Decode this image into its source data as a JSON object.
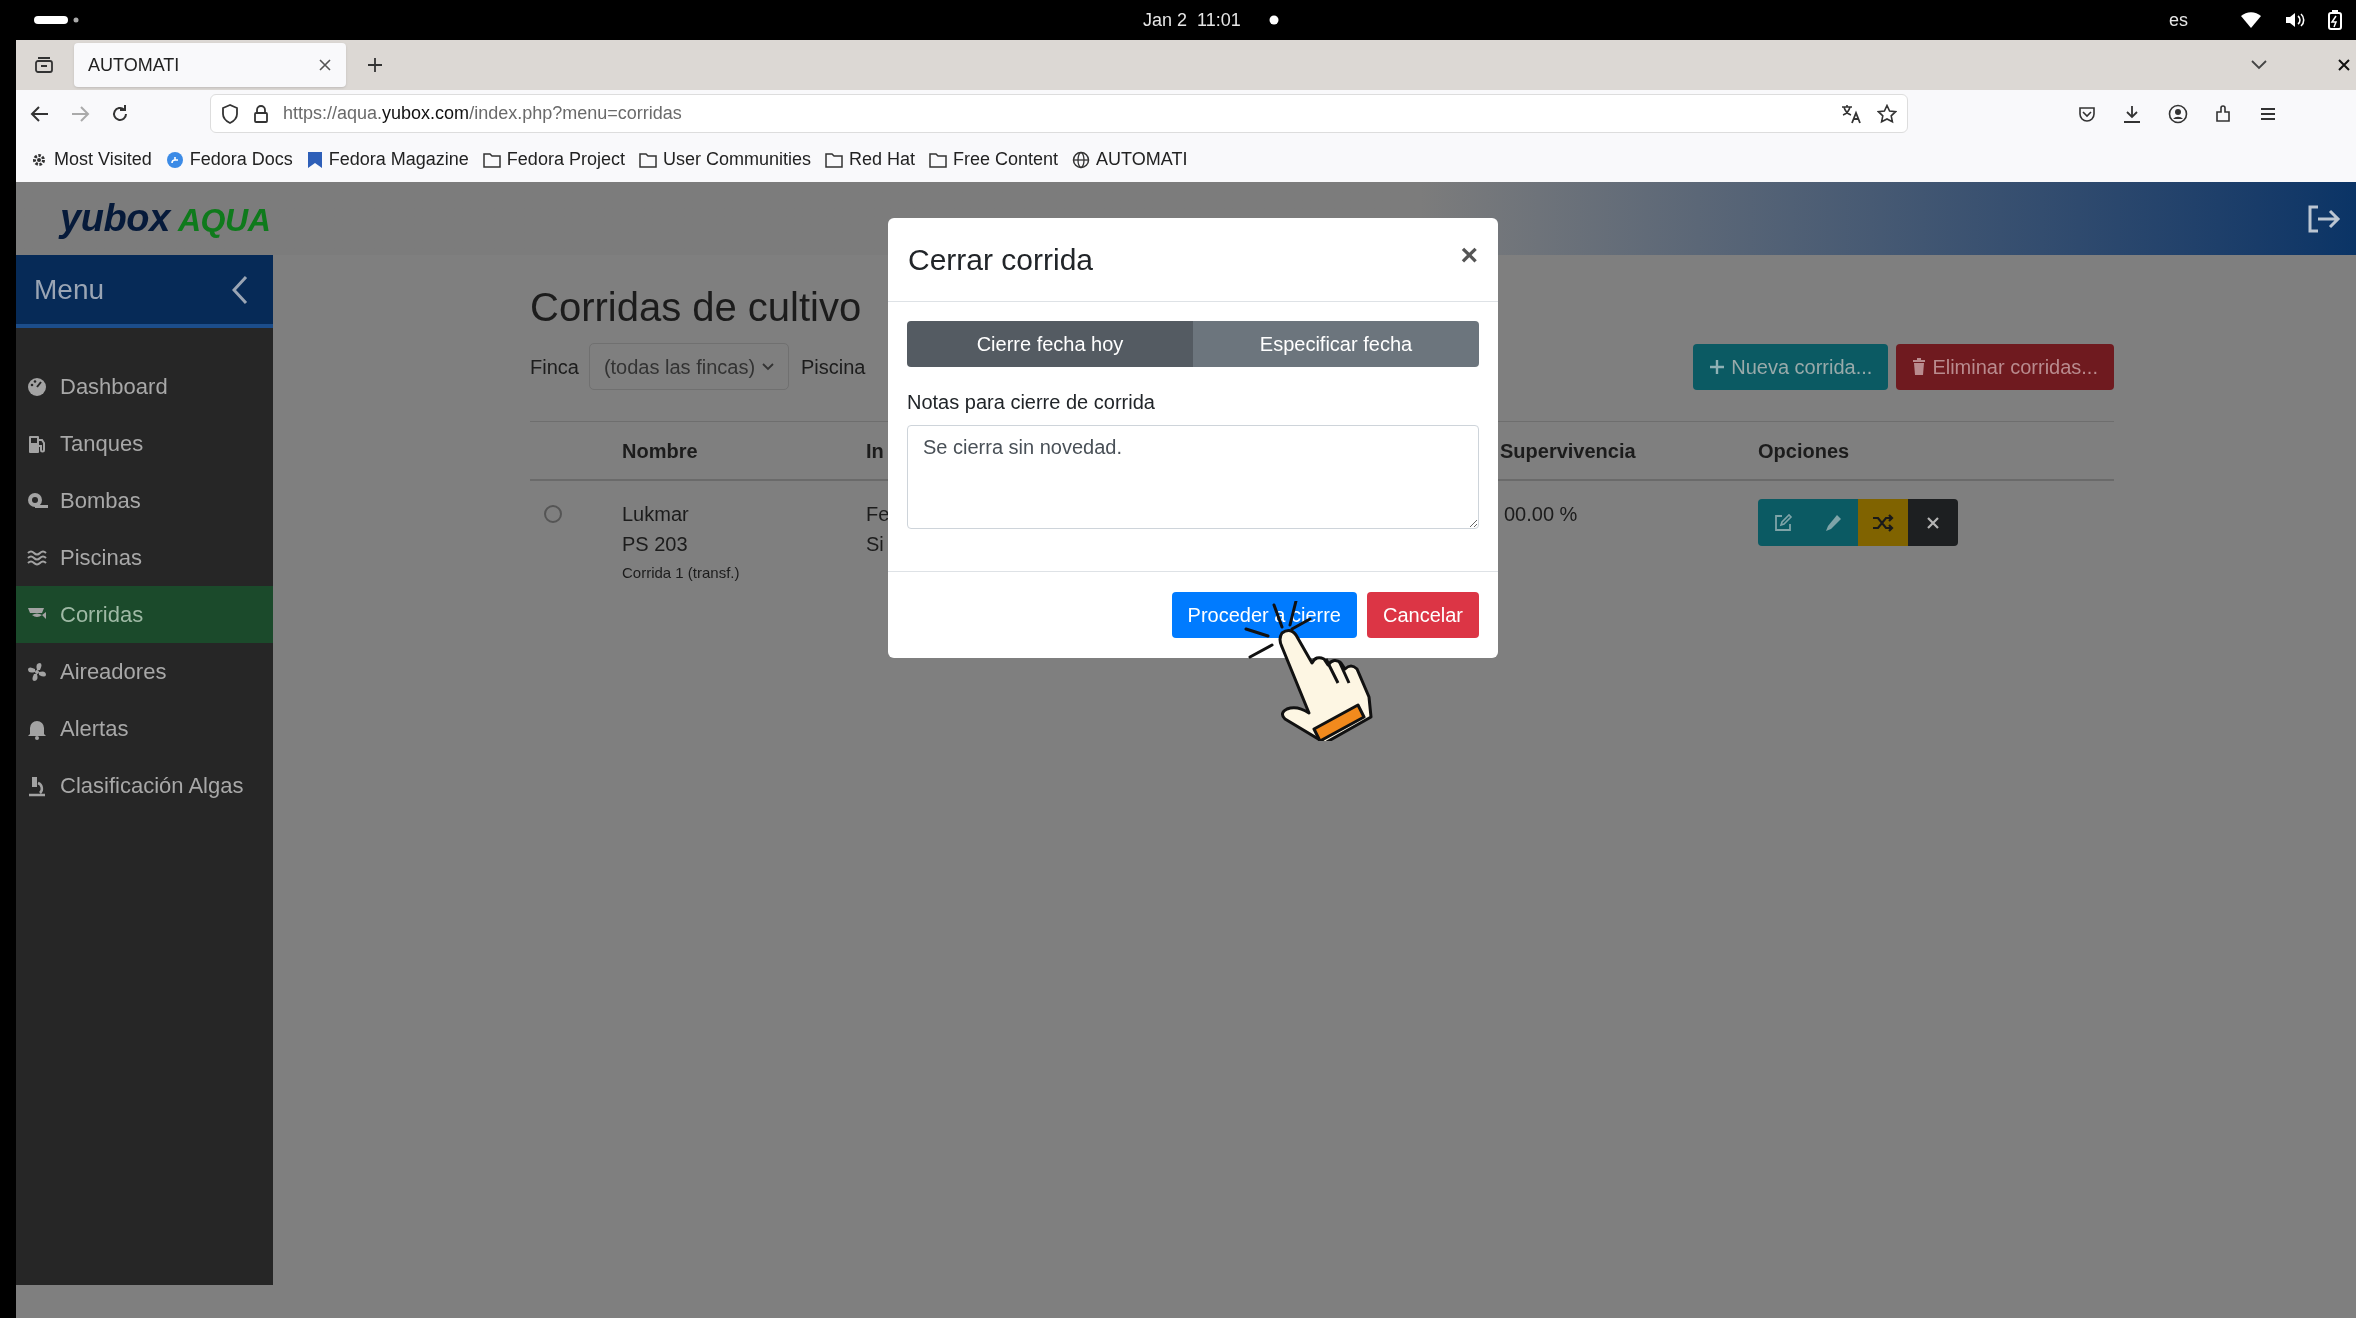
{
  "status_bar": {
    "date": "Jan 2",
    "time": "11:01",
    "language": "es"
  },
  "browser": {
    "tabs": [
      {
        "title": "AUTOMATI",
        "selected": true
      }
    ],
    "url": {
      "scheme_sub": "https://aqua.",
      "domain": "yubox.com",
      "path": "/index.php?menu=corridas"
    },
    "bookmarks": [
      {
        "label": "Most Visited",
        "kind": "gear"
      },
      {
        "label": "Fedora Docs",
        "kind": "docs"
      },
      {
        "label": "Fedora Magazine",
        "kind": "magazine"
      },
      {
        "label": "Fedora Project",
        "kind": "folder"
      },
      {
        "label": "User Communities",
        "kind": "folder"
      },
      {
        "label": "Red Hat",
        "kind": "folder"
      },
      {
        "label": "Free Content",
        "kind": "folder"
      },
      {
        "label": "AUTOMATI",
        "kind": "globe"
      }
    ]
  },
  "app": {
    "logo": {
      "word": "yubox",
      "accent": "AQUA"
    },
    "sidebar": {
      "title": "Menu",
      "items": [
        {
          "label": "Dashboard",
          "kind": "gauge",
          "selected": false
        },
        {
          "label": "Tanques",
          "kind": "tank",
          "selected": false
        },
        {
          "label": "Bombas",
          "kind": "pump",
          "selected": false
        },
        {
          "label": "Piscinas",
          "kind": "water",
          "selected": false
        },
        {
          "label": "Corridas",
          "kind": "fish",
          "selected": true
        },
        {
          "label": "Aireadores",
          "kind": "fan",
          "selected": false
        },
        {
          "label": "Alertas",
          "kind": "bell",
          "selected": false
        },
        {
          "label": "Clasificación Algas",
          "kind": "microscope",
          "selected": false
        }
      ]
    },
    "page": {
      "title": "Corridas de cultivo",
      "filters": [
        {
          "label": "Finca",
          "value": "(todas las fincas)"
        },
        {
          "label": "Piscina"
        }
      ],
      "buttons": [
        {
          "label": "Nueva corrida...",
          "kind": "new"
        },
        {
          "label": "Eliminar corridas...",
          "kind": "delete"
        }
      ],
      "table": {
        "columns": [
          "Nombre",
          "In",
          "Supervivencia",
          "Opciones"
        ],
        "rows": [
          {
            "selected": false,
            "name_lines": [
              "Lukmar",
              "PS 203"
            ],
            "subtitle": "Corrida 1 (transf.)",
            "column_3": [
              "Fe",
              "Si"
            ],
            "survival": "00.00 %",
            "actions": [
              {
                "kind": "edit"
              },
              {
                "kind": "pencil"
              },
              {
                "kind": "shuffle"
              },
              {
                "kind": "close"
              }
            ]
          }
        ]
      }
    },
    "dialog": {
      "title": "Cerrar corrida",
      "close": "×",
      "tabs": [
        {
          "label": "Cierre fecha hoy",
          "selected": true
        },
        {
          "label": "Especificar fecha",
          "selected": false
        }
      ],
      "notes_label": "Notas para cierre de corrida",
      "notes_value": "Se cierra sin novedad.",
      "buttons": [
        {
          "label": "Proceder a cierre",
          "kind": "primary"
        },
        {
          "label": "Cancelar",
          "kind": "danger"
        }
      ]
    }
  }
}
